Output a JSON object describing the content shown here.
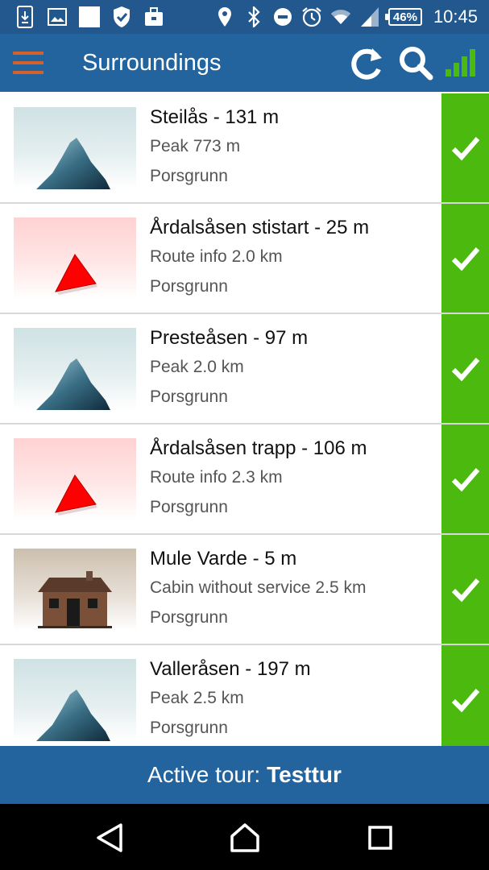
{
  "status_bar": {
    "battery": "46%",
    "time": "10:45",
    "icons": [
      "download-icon",
      "image-icon",
      "blank-square-icon",
      "shield-check-icon",
      "briefcase-icon",
      "location-icon",
      "bluetooth-icon",
      "do-not-disturb-icon",
      "alarm-icon",
      "wifi-icon",
      "cell-signal-icon",
      "battery-icon"
    ]
  },
  "app_bar": {
    "title": "Surroundings",
    "icons": [
      "menu-icon",
      "refresh-icon",
      "search-icon",
      "signal-strength-icon"
    ],
    "menu_color": "#d4622a",
    "signal_color": "#4cb90e"
  },
  "items": [
    {
      "title": "Steilås - 131 m",
      "subtitle": "Peak 773 m",
      "location": "Porsgrunn",
      "type": "peak"
    },
    {
      "title": "Årdalsåsen stistart - 25 m",
      "subtitle": "Route info 2.0 km",
      "location": "Porsgrunn",
      "type": "route"
    },
    {
      "title": "Presteåsen - 97 m",
      "subtitle": "Peak 2.0 km",
      "location": "Porsgrunn",
      "type": "peak"
    },
    {
      "title": "Årdalsåsen trapp - 106 m",
      "subtitle": "Route info 2.3 km",
      "location": "Porsgrunn",
      "type": "route"
    },
    {
      "title": "Mule Varde - 5 m",
      "subtitle": "Cabin without service 2.5 km",
      "location": "Porsgrunn",
      "type": "cabin"
    },
    {
      "title": "Valleråsen - 197 m",
      "subtitle": "Peak 2.5 km",
      "location": "Porsgrunn",
      "type": "peak"
    }
  ],
  "tour_bar": {
    "label": "Active tour:",
    "tour_name": "Testtur"
  },
  "colors": {
    "status_bar": "#23588e",
    "app_bar": "#23649f",
    "check": "#4cb90e"
  }
}
